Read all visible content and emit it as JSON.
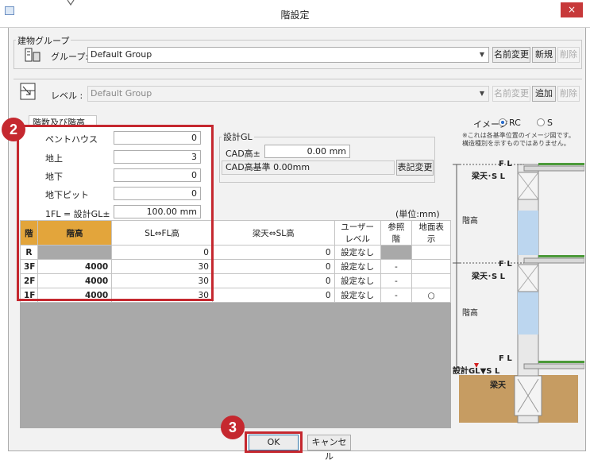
{
  "window": {
    "title": "階設定",
    "close": "×"
  },
  "building_group": {
    "legend": "建物グループ",
    "label": "グループ:",
    "value": "Default Group",
    "rename": "名前変更",
    "new": "新規",
    "delete": "削除"
  },
  "level": {
    "label": "レベル :",
    "value": "Default Group",
    "rename": "名前変更",
    "add": "追加",
    "delete": "削除"
  },
  "floors": {
    "tab": "階数及び階高",
    "penthouse_label": "ペントハウス",
    "penthouse": "0",
    "above_label": "地上",
    "above": "3",
    "below_label": "地下",
    "below": "0",
    "pit_label": "地下ピット",
    "pit": "0",
    "fl_label": "1FL = 設計GL±",
    "fl_value": "100.00",
    "fl_unit": "mm"
  },
  "design_gl": {
    "legend": "設計GL",
    "cad_label": "CAD高±",
    "cad_value": "0.00",
    "cad_unit": "mm",
    "base_text": "CAD高基準 0.00mm",
    "switch": "表記変更"
  },
  "unit": "(単位:mm)",
  "table": {
    "headers": [
      "階",
      "階高",
      "SL⇔FL高",
      "梁天⇔SL高",
      "ユーザーレベル",
      "参照階",
      "地面表示"
    ],
    "rows": [
      [
        "R",
        "",
        "0",
        "0",
        "設定なし",
        "",
        ""
      ],
      [
        "3F",
        "4000",
        "30",
        "0",
        "設定なし",
        "-",
        ""
      ],
      [
        "2F",
        "4000",
        "30",
        "0",
        "設定なし",
        "-",
        ""
      ],
      [
        "1F",
        "4000",
        "30",
        "0",
        "設定なし",
        "-",
        "○"
      ]
    ]
  },
  "image_panel": {
    "label": "イメージ",
    "rc": "RC",
    "s": "S",
    "selected": "RC",
    "note1": "※これは各基準位置のイメージ図です。",
    "note2": "構造種別を示すものではありません。"
  },
  "diagram": {
    "fl": "F L",
    "beam_sl": "梁天･S L",
    "story_height": "階高",
    "gl_sl": "設計GL▼S L",
    "beam": "梁天"
  },
  "buttons": {
    "ok": "OK",
    "cancel": "キャンセル"
  },
  "callouts": {
    "two": "2",
    "three": "3"
  },
  "colors": {
    "accent_red": "#c5282f",
    "header_orange": "#e3a53b"
  }
}
